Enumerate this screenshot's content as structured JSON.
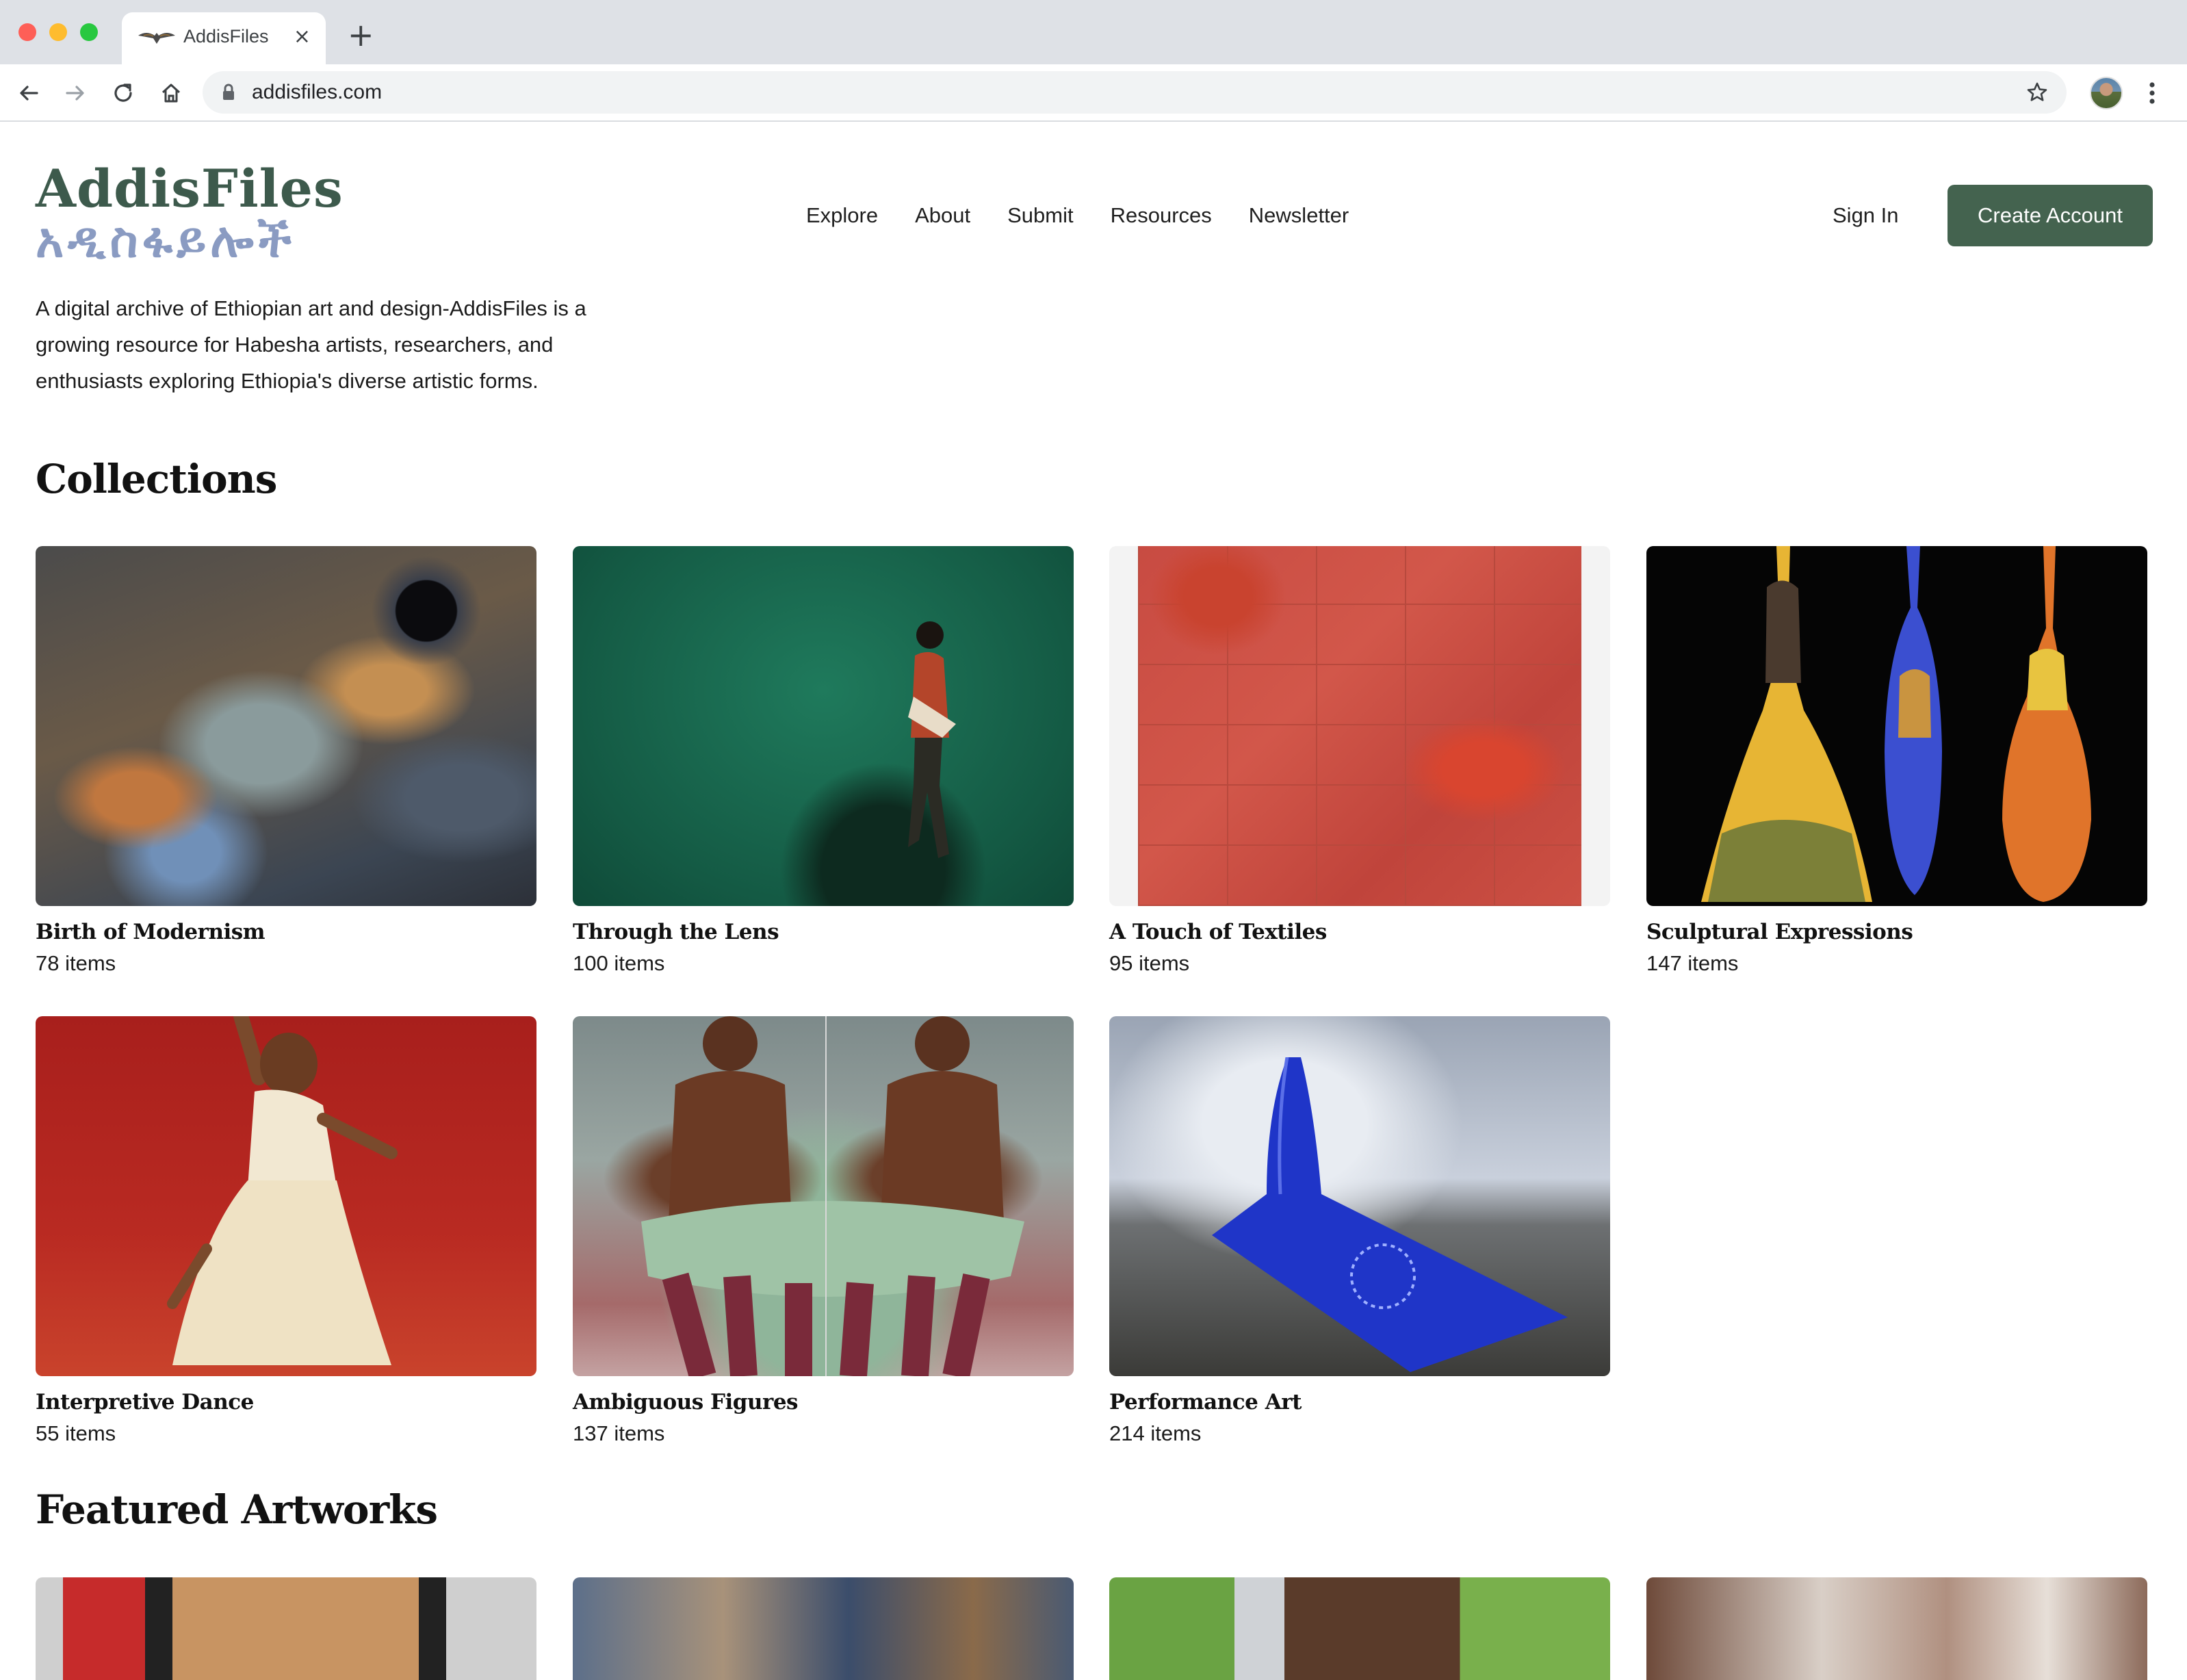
{
  "browser": {
    "tab_title": "AddisFiles",
    "tab_close": "×",
    "new_tab": "+",
    "url": "addisfiles.com"
  },
  "logo": {
    "latin": "AddisFiles",
    "geez": "አዲስፋይሎች"
  },
  "nav": {
    "items": [
      "Explore",
      "About",
      "Submit",
      "Resources",
      "Newsletter"
    ],
    "sign_in": "Sign In",
    "create_account": "Create Account"
  },
  "intro": {
    "line1": "A digital archive of Ethiopian art and design-AddisFiles is a",
    "line2": "growing resource for Habesha artists, researchers, and",
    "line3": "enthusiasts exploring Ethiopia's diverse artistic forms."
  },
  "collections": {
    "title": "Collections",
    "items": [
      {
        "title": "Birth of Modernism",
        "count": "78 items"
      },
      {
        "title": "Through the Lens",
        "count": "100 items"
      },
      {
        "title": "A Touch of Textiles",
        "count": "95 items"
      },
      {
        "title": "Sculptural Expressions",
        "count": "147 items"
      },
      {
        "title": "Interpretive Dance",
        "count": "55 items"
      },
      {
        "title": "Ambiguous Figures",
        "count": "137 items"
      },
      {
        "title": "Performance Art",
        "count": "214 items"
      }
    ]
  },
  "featured": {
    "title": "Featured Artworks"
  },
  "colors": {
    "brand_green": "#44634f",
    "logo_green": "#3d5a4c",
    "logo_blue": "#8a9bc2"
  }
}
